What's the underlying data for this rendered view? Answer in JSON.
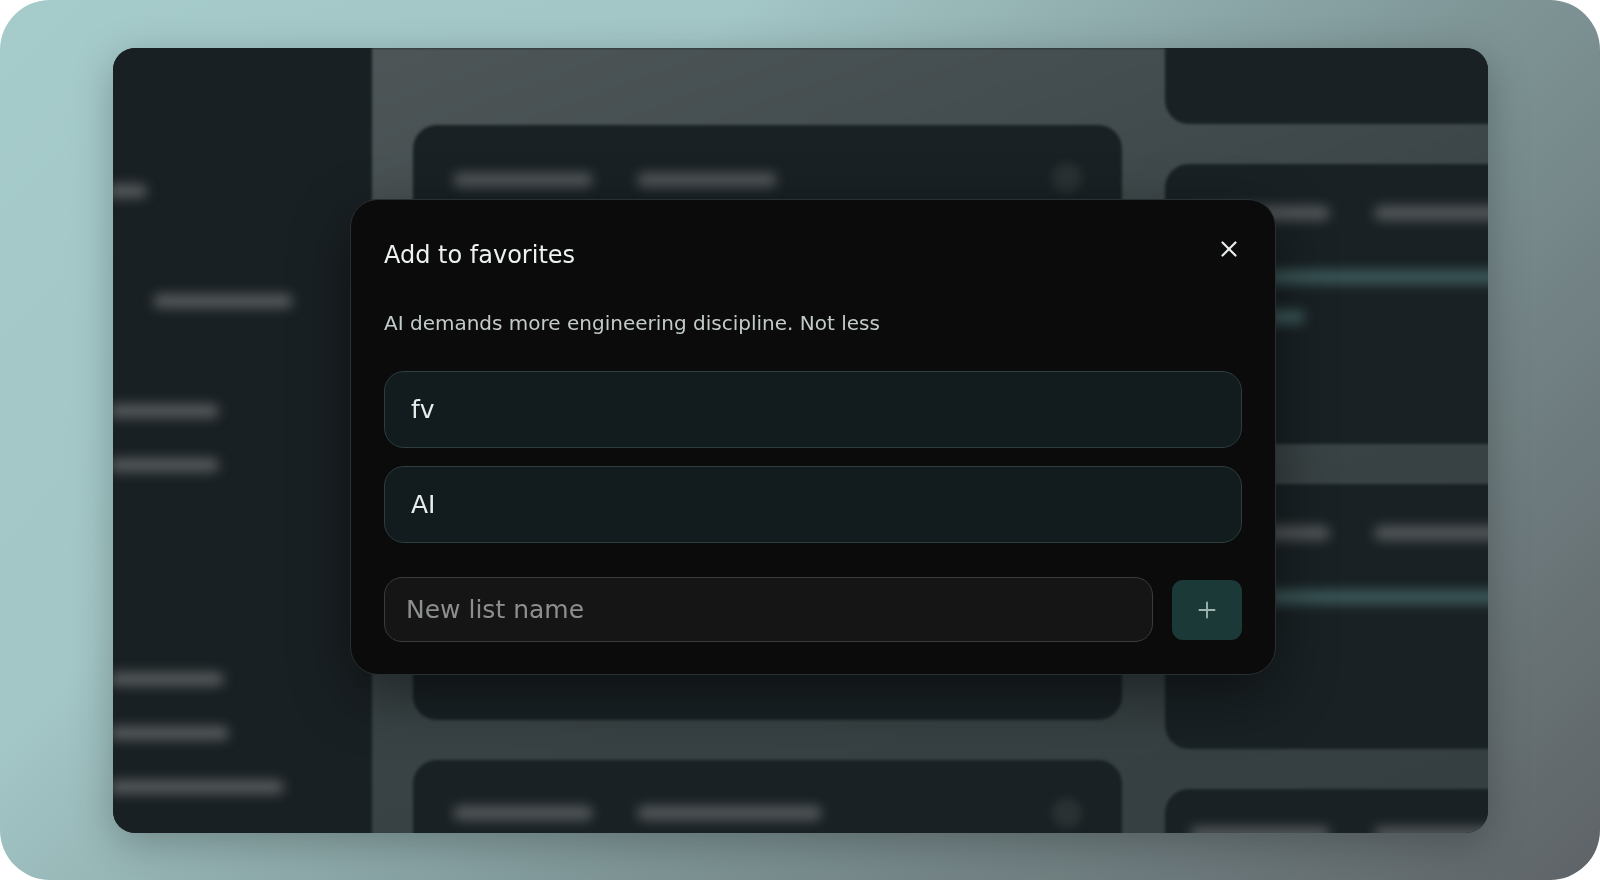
{
  "dialog": {
    "title": "Add to favorites",
    "subtitle": "AI demands more engineering discipline. Not less",
    "lists": [
      {
        "name": "fv"
      },
      {
        "name": "AI"
      }
    ],
    "new_list": {
      "placeholder": "New list name"
    }
  }
}
